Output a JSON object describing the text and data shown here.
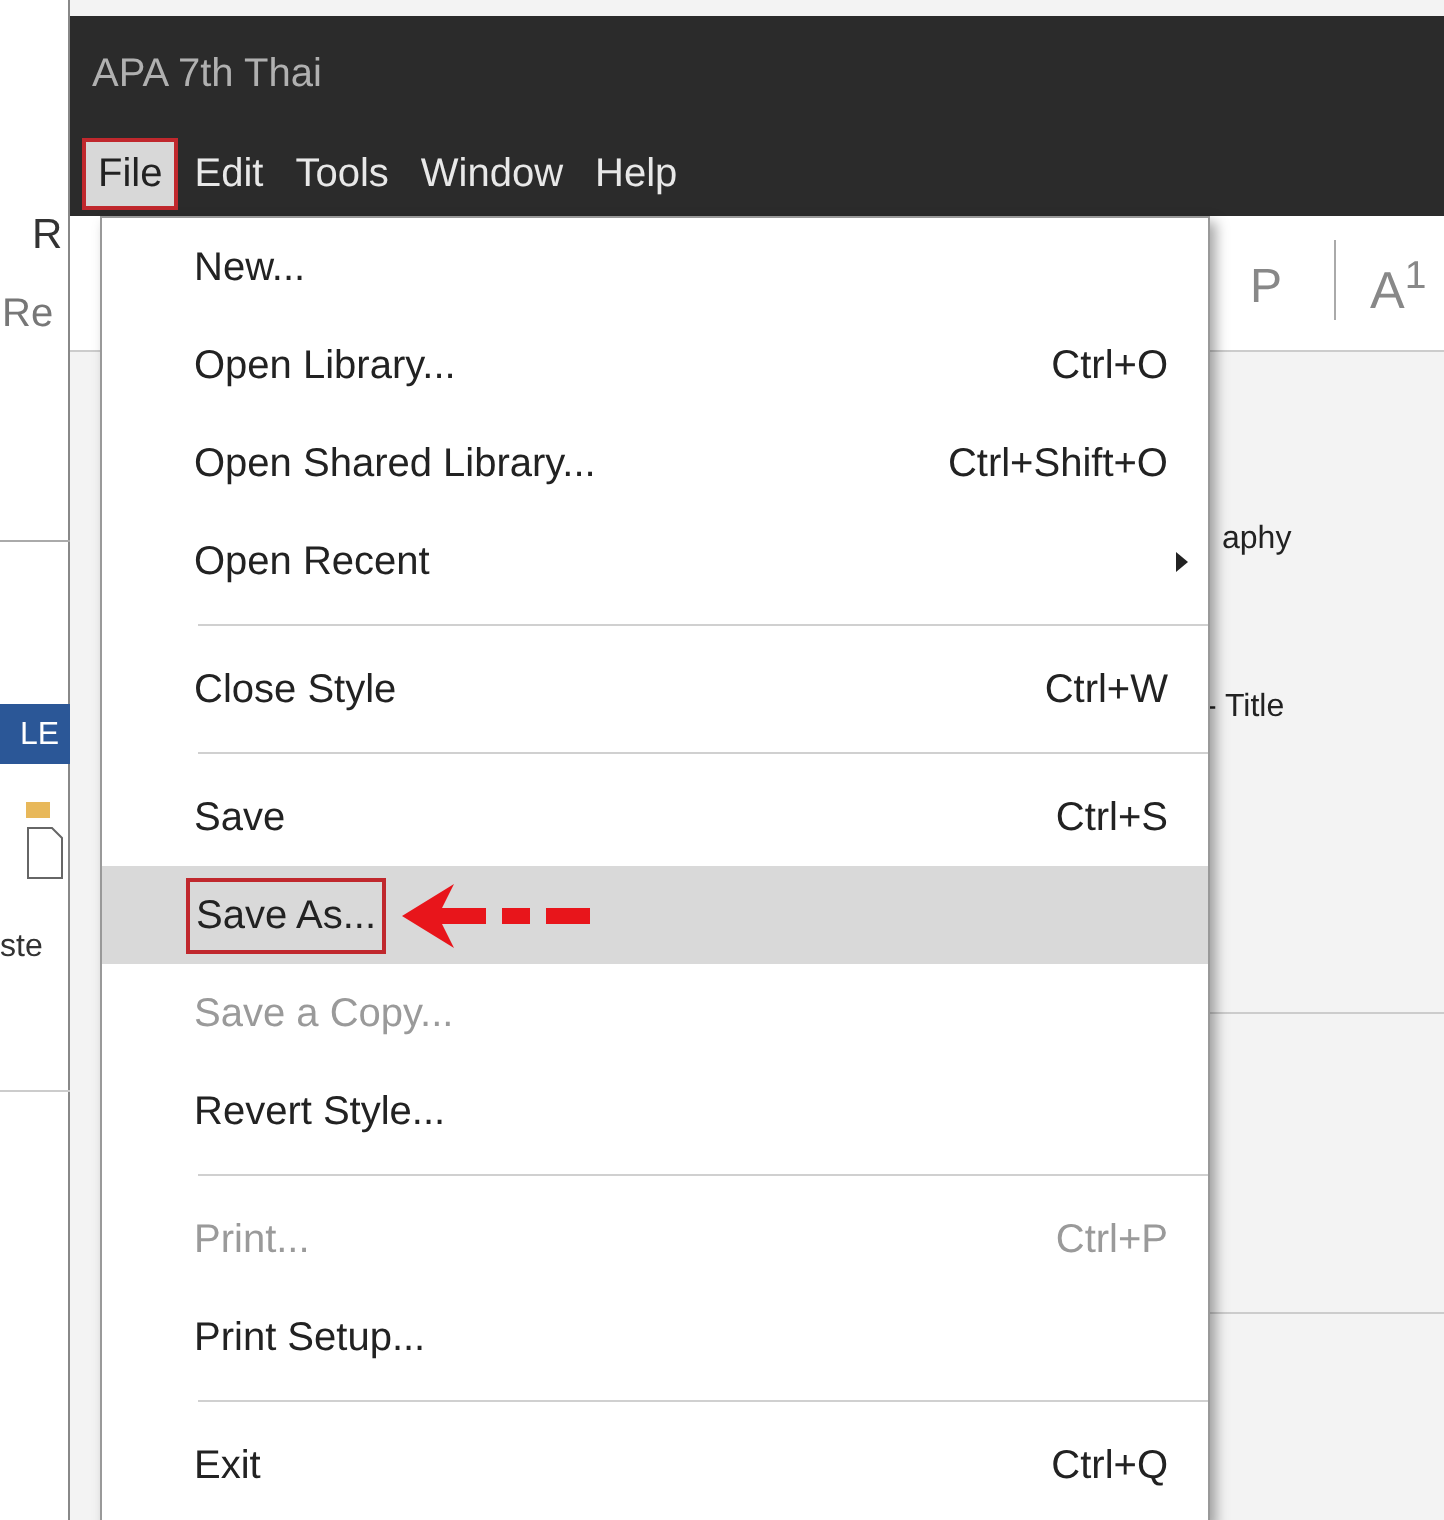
{
  "window": {
    "title": "APA 7th Thai"
  },
  "menu_bar": [
    {
      "label": "File",
      "selected": true,
      "marked": true
    },
    {
      "label": "Edit",
      "selected": false,
      "marked": false
    },
    {
      "label": "Tools",
      "selected": false,
      "marked": false
    },
    {
      "label": "Window",
      "selected": false,
      "marked": false
    },
    {
      "label": "Help",
      "selected": false,
      "marked": false
    }
  ],
  "file_menu": [
    {
      "kind": "item",
      "label": "New...",
      "disabled": false,
      "selected": false,
      "marked": false
    },
    {
      "kind": "item",
      "label": "Open Library...",
      "shortcut": "Ctrl+O",
      "disabled": false,
      "selected": false,
      "marked": false
    },
    {
      "kind": "item",
      "label": "Open Shared Library...",
      "shortcut": "Ctrl+Shift+O",
      "disabled": false,
      "selected": false,
      "marked": false
    },
    {
      "kind": "item",
      "label": "Open Recent",
      "submenu": true,
      "disabled": false,
      "selected": false,
      "marked": false
    },
    {
      "kind": "separator"
    },
    {
      "kind": "item",
      "label": "Close Style",
      "shortcut": "Ctrl+W",
      "disabled": false,
      "selected": false,
      "marked": false
    },
    {
      "kind": "separator"
    },
    {
      "kind": "item",
      "label": "Save",
      "shortcut": "Ctrl+S",
      "disabled": false,
      "selected": false,
      "marked": false
    },
    {
      "kind": "item",
      "label": "Save As...",
      "disabled": false,
      "selected": true,
      "marked": true
    },
    {
      "kind": "item",
      "label": "Save a Copy...",
      "disabled": true,
      "selected": false,
      "marked": false
    },
    {
      "kind": "item",
      "label": "Revert Style...",
      "disabled": false,
      "selected": false,
      "marked": false
    },
    {
      "kind": "separator"
    },
    {
      "kind": "item",
      "label": "Print...",
      "shortcut": "Ctrl+P",
      "disabled": true,
      "selected": false,
      "marked": false
    },
    {
      "kind": "item",
      "label": "Print Setup...",
      "disabled": false,
      "selected": false,
      "marked": false
    },
    {
      "kind": "separator"
    },
    {
      "kind": "item",
      "label": "Exit",
      "shortcut": "Ctrl+Q",
      "disabled": false,
      "selected": false,
      "marked": false
    }
  ],
  "background": {
    "left_panel": [
      "R",
      "Re",
      "LE",
      "ste"
    ],
    "toolbar": [
      "P",
      "A$^{1}$"
    ],
    "content": [
      "aphy",
      "- Title"
    ]
  }
}
